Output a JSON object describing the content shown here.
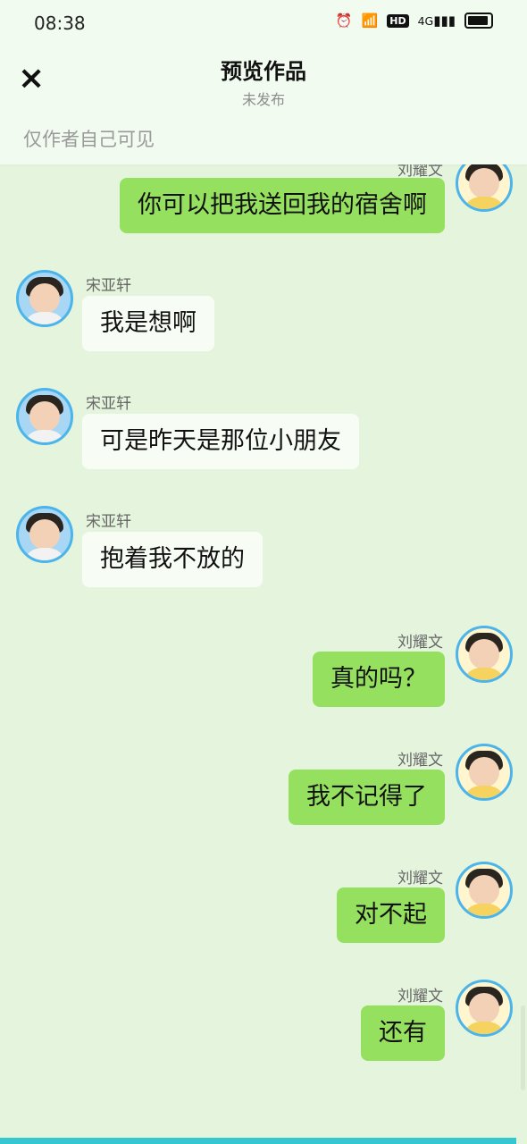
{
  "status_bar": {
    "time": "08:38",
    "icons": [
      "alarm-icon",
      "wifi-icon",
      "hd-icon",
      "4g-signal-icon",
      "battery-icon"
    ],
    "hd_label": "HD",
    "network_label": "4G"
  },
  "header": {
    "title": "预览作品",
    "subtitle": "未发布",
    "visibility": "仅作者自己可见"
  },
  "messages": [
    {
      "side": "right",
      "name": "刘耀文",
      "text": "你可以把我送回我的宿舍啊"
    },
    {
      "side": "left",
      "name": "宋亚轩",
      "text": "我是想啊"
    },
    {
      "side": "left",
      "name": "宋亚轩",
      "text": "可是昨天是那位小朋友"
    },
    {
      "side": "left",
      "name": "宋亚轩",
      "text": "抱着我不放的"
    },
    {
      "side": "right",
      "name": "刘耀文",
      "text": "真的吗？"
    },
    {
      "side": "right",
      "name": "刘耀文",
      "text": "我不记得了"
    },
    {
      "side": "right",
      "name": "刘耀文",
      "text": "对不起"
    },
    {
      "side": "right",
      "name": "刘耀文",
      "text": "还有"
    }
  ],
  "colors": {
    "background": "#e5f4dc",
    "right_bubble": "#95e05f",
    "left_bubble": "#f7fdf5",
    "avatar_border": "#4bb4ea",
    "bottom_bar": "#34c7cf"
  }
}
